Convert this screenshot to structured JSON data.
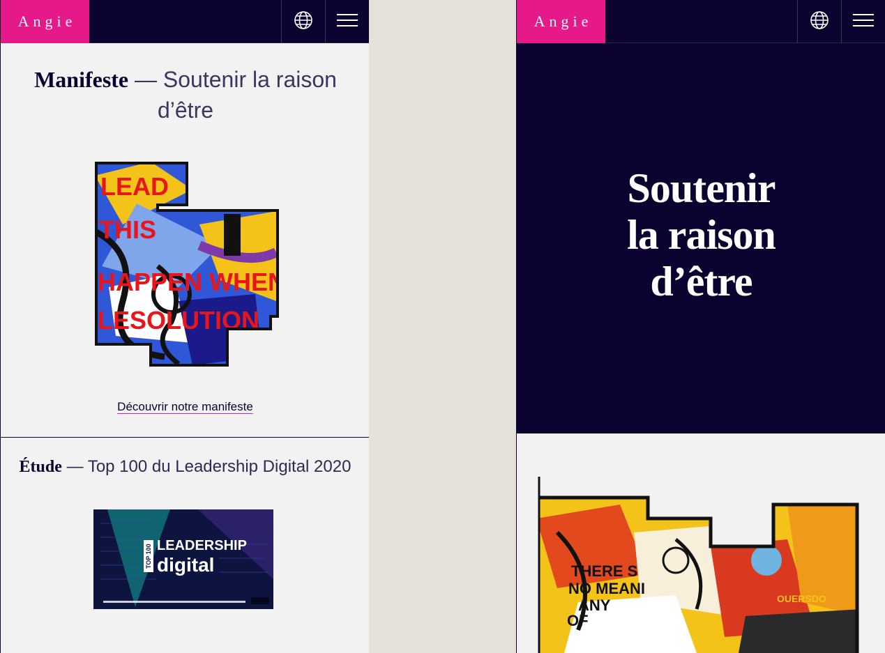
{
  "left": {
    "brand": "Angie",
    "manifest": {
      "label": "Manifeste",
      "separator": " — ",
      "title": "Soutenir la raison d’être",
      "link": "Découvrir notre manifeste"
    },
    "study": {
      "label": "Étude",
      "separator": " — ",
      "title": "Top 100 du Leadership Digital 2020",
      "image": {
        "badge": "TOP 100",
        "line1": "LEADERSHIP",
        "line2": "digital"
      }
    },
    "icons": [
      "globe-icon",
      "menu-icon"
    ]
  },
  "right": {
    "brand": "Angie",
    "hero": {
      "line1": "Soutenir",
      "line2": "la raison",
      "line3": "d’être"
    },
    "artwork": {
      "text1": "THERE S",
      "text2": "NO MEANI",
      "text3": "ANY",
      "text4": "OF",
      "text5": "OUERSDO"
    }
  },
  "colors": {
    "navy": "#0b0230",
    "pink": "#e6198b",
    "page": "#f2f2f2",
    "gap": "#e7e1dc"
  }
}
